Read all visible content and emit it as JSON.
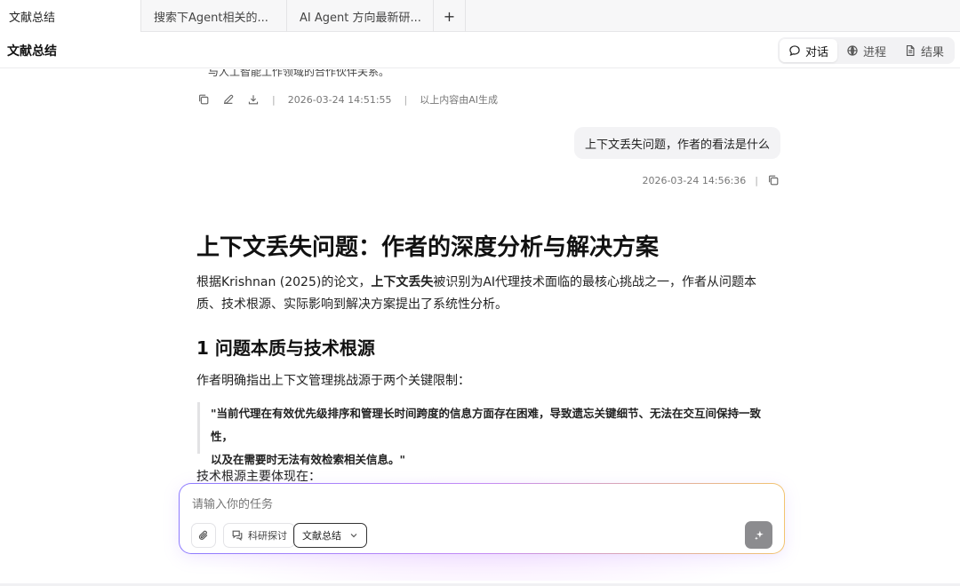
{
  "tabs": [
    {
      "label": "文献总结",
      "active": true
    },
    {
      "label": "搜索下Agent相关的..."
    },
    {
      "label": "AI Agent 方向最新研..."
    }
  ],
  "tab_add_label": "+",
  "header": {
    "title": "文献总结",
    "views": [
      {
        "label": "对话",
        "icon": "chat-bubble-icon",
        "active": true
      },
      {
        "label": "进程",
        "icon": "globe-icon"
      },
      {
        "label": "结果",
        "icon": "document-icon"
      }
    ]
  },
  "conversation": {
    "cut_text": "与人工智能工作领域的合作伙伴关系。",
    "prev_message": {
      "timestamp": "2026-03-24 14:51:55",
      "note": "以上内容由AI生成"
    },
    "user_message": {
      "text": "上下文丢失问题，作者的看法是什么",
      "timestamp": "2026-03-24 14:56:36"
    },
    "answer": {
      "h1": "上下文丢失问题：作者的深度分析与解决方案",
      "p1_before": "根据Krishnan (2025)的论文，",
      "p1_bold": "上下文丢失",
      "p1_after": "被识别为AI代理技术面临的最核心挑战之一，作者从问题本质、技术根源、实际影响到解决方案提出了系统性分析。",
      "h2": "1 问题本质与技术根源",
      "p2": "作者明确指出上下文管理挑战源于两个关键限制：",
      "quote_line1": "\"当前代理在有效优先级排序和管理长时间跨度的信息方面存在困难，导致遗忘关键细节、无法在交互间保持一致性，",
      "quote_line2": "以及在需要时无法有效检索相关信息。\"",
      "p3": "技术根源主要体现在："
    }
  },
  "composer": {
    "placeholder": "请输入你的任务",
    "mode_label": "科研探讨",
    "select_value": "文献总结"
  }
}
